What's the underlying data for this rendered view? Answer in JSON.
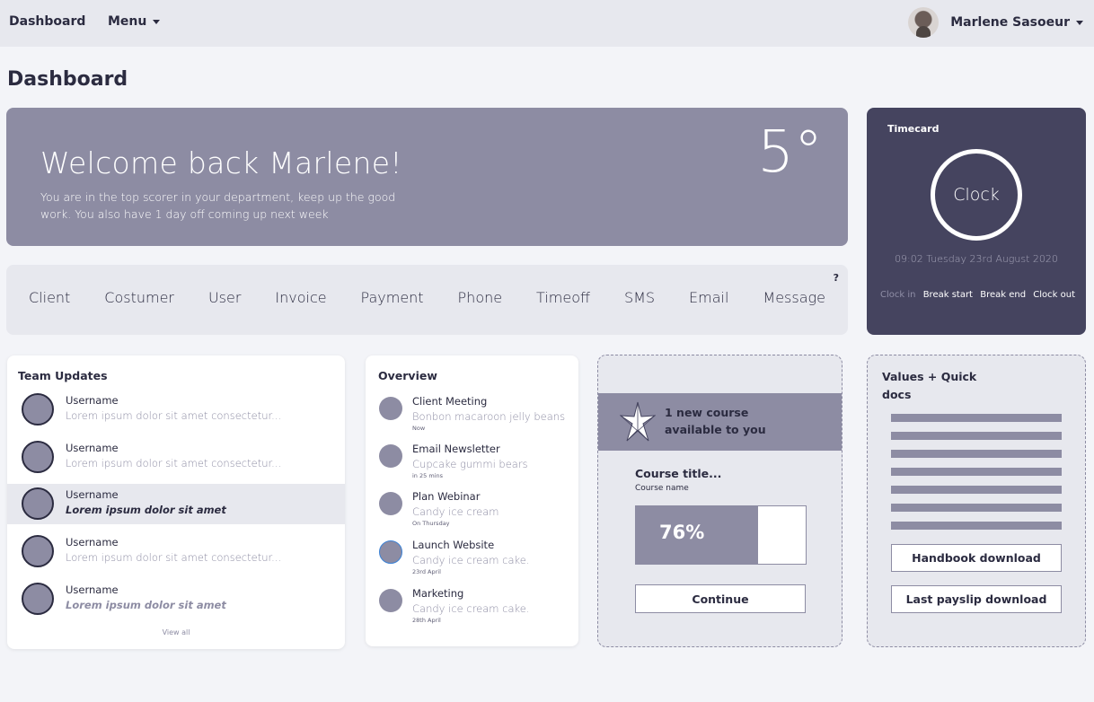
{
  "topbar": {
    "brand": "Dashboard",
    "menu_label": "Menu",
    "user_name": "Marlene Sasoeur"
  },
  "page": {
    "title": "Dashboard"
  },
  "welcome": {
    "headline": "Welcome back Marlene!",
    "message": "You are in the top scorer in your department, keep up the good work. You also have 1 day off coming up next week",
    "temperature": "5°"
  },
  "shortcuts": {
    "help": "?",
    "items": [
      "Client",
      "Costumer",
      "User",
      "Invoice",
      "Payment",
      "Phone",
      "Timeoff",
      "SMS",
      "Email",
      "Message"
    ]
  },
  "timecard": {
    "title": "Timecard",
    "clock_label": "Clock",
    "datetime": "09:02 Tuesday 23rd August 2020",
    "actions": [
      "Clock in",
      "Break start",
      "Break end",
      "Clock out"
    ]
  },
  "team_updates": {
    "title": "Team Updates",
    "items": [
      {
        "username": "Username",
        "message": "Lorem ipsum dolor sit amet consectetur..."
      },
      {
        "username": "Username",
        "message": "Lorem ipsum dolor sit amet consectetur..."
      },
      {
        "username": "Username",
        "message": "Lorem ipsum dolor sit amet"
      },
      {
        "username": "Username",
        "message": "Lorem ipsum dolor sit amet consectetur..."
      },
      {
        "username": "Username",
        "message": "Lorem ipsum dolor sit amet"
      }
    ],
    "view_all": "View all"
  },
  "overview": {
    "title": "Overview",
    "items": [
      {
        "title": "Client Meeting",
        "subtitle": "Bonbon macaroon jelly beans",
        "when": "Now"
      },
      {
        "title": "Email Newsletter",
        "subtitle": "Cupcake gummi bears",
        "when": "in 25 mins"
      },
      {
        "title": "Plan Webinar",
        "subtitle": "Candy ice cream",
        "when": "On Thursday"
      },
      {
        "title": "Launch Website",
        "subtitle": "Candy ice cream cake.",
        "when": "23rd April"
      },
      {
        "title": "Marketing",
        "subtitle": "Candy ice cream cake.",
        "when": "28th April"
      }
    ]
  },
  "course": {
    "banner_text": "1 new course available to you",
    "course_title": "Course title...",
    "course_name": "Course name",
    "progress": 0.72,
    "progress_label": "76%",
    "continue_label": "Continue"
  },
  "docs": {
    "title": "Values + Quick docs",
    "handbook_label": "Handbook download",
    "payslip_label": "Last payslip download"
  },
  "colors": {
    "accent": "#8d8ca3",
    "dark_panel": "#45445f",
    "text": "#2b2b40",
    "surface": "#e7e8ee",
    "background": "#f3f4f8"
  }
}
